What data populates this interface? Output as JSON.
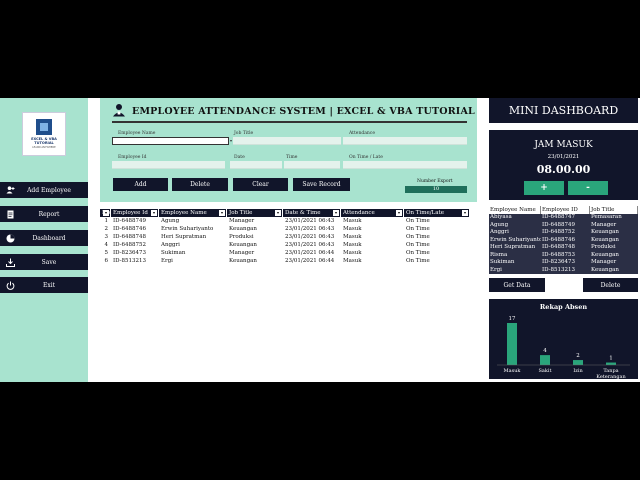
{
  "sidebar": {
    "logo_text": "EXCEL & VBA TUTORIAL",
    "logo_sub": "LEARN ANYWHERE",
    "items": [
      {
        "label": "Add Employee",
        "icon": "add-user-icon"
      },
      {
        "label": "Report",
        "icon": "report-icon"
      },
      {
        "label": "Dashboard",
        "icon": "pie-chart-icon"
      },
      {
        "label": "Save",
        "icon": "download-icon"
      },
      {
        "label": "Exit",
        "icon": "power-icon"
      }
    ]
  },
  "header": {
    "title": "EMPLOYEE ATTENDANCE SYSTEM | EXCEL & VBA TUTORIAL",
    "icon": "employee-icon"
  },
  "form": {
    "labels": {
      "employee_name": "Employee Name",
      "job_title": "Job Title",
      "attendance": "Attendance",
      "employee_id": "Employee Id",
      "date": "Date",
      "time": "Time",
      "on_time_late": "On Time / Late"
    },
    "buttons": {
      "add": "Add",
      "delete": "Delete",
      "clear": "Clear",
      "save_record": "Save Record"
    },
    "number_export_label": "Number Export",
    "number_export_value": "10"
  },
  "table": {
    "columns": [
      "No",
      "Employee Id",
      "Employee Name",
      "Job Title",
      "Date & Time",
      "Attendance",
      "On Time/Late"
    ],
    "rows": [
      [
        "1",
        "ID-6488749",
        "Agung",
        "Manager",
        "23/01/2021 06:43",
        "Masuk",
        "On Time"
      ],
      [
        "2",
        "ID-6488746",
        "Erwin Suhariyanto",
        "Keuangan",
        "23/01/2021 06:43",
        "Masuk",
        "On Time"
      ],
      [
        "3",
        "ID-6488748",
        "Heri Supratman",
        "Produksi",
        "23/01/2021 06:43",
        "Masuk",
        "On Time"
      ],
      [
        "4",
        "ID-6488752",
        "Anggri",
        "Keuangan",
        "23/01/2021 06:43",
        "Masuk",
        "On Time"
      ],
      [
        "5",
        "ID-8236473",
        "Sukiman",
        "Manager",
        "23/01/2021 06:44",
        "Masuk",
        "On Time"
      ],
      [
        "6",
        "ID-8513213",
        "Ergi",
        "Keuangan",
        "23/01/2021 06:44",
        "Masuk",
        "On Time"
      ]
    ]
  },
  "dashboard": {
    "title": "MINI DASHBOARD",
    "jam_title": "JAM MASUK",
    "jam_date": "23/01/2021",
    "jam_time": "08.00.00",
    "plus_label": "+",
    "minus_label": "-",
    "mini_table": {
      "columns": [
        "Employee Name",
        "Employee ID",
        "Job Title"
      ],
      "rows": [
        [
          "Abiyasa",
          "ID-6488747",
          "Pemasaran"
        ],
        [
          "Agung",
          "ID-6488749",
          "Manager"
        ],
        [
          "Anggri",
          "ID-6488752",
          "Keuangan"
        ],
        [
          "Erwin Suhariyanto",
          "ID-6488746",
          "Keuangan"
        ],
        [
          "Heri Supratman",
          "ID-6488748",
          "Produksi"
        ],
        [
          "Risma",
          "ID-6488753",
          "Keuangan"
        ],
        [
          "Sukiman",
          "ID-8236473",
          "Manager"
        ],
        [
          "Ergi",
          "ID-8513213",
          "Keuangan"
        ]
      ]
    },
    "get_data_label": "Get Data",
    "delete_label": "Delete"
  },
  "chart_data": {
    "type": "bar",
    "title": "Rekap Absen",
    "categories": [
      "Masuk",
      "Sakit",
      "Izin",
      "Tanpa Keterangan"
    ],
    "values": [
      17,
      4,
      2,
      1
    ],
    "ylim": [
      0,
      17
    ],
    "grid": false,
    "bar_color": "#2aa57b"
  }
}
